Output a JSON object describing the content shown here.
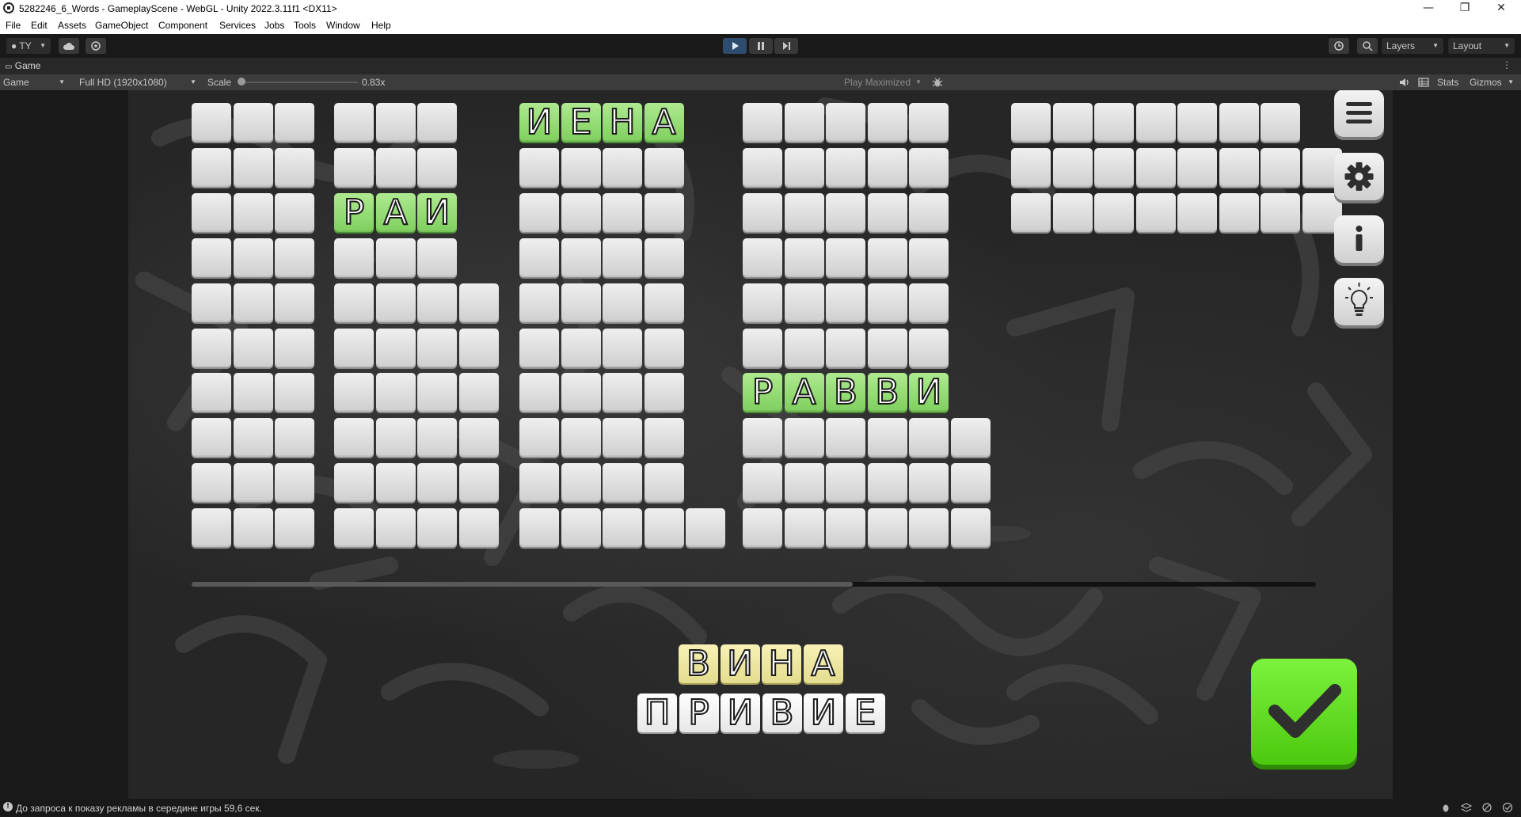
{
  "window": {
    "title": "5282246_6_Words - GameplayScene - WebGL - Unity 2022.3.11f1 <DX11>",
    "minimize": "—",
    "maximize": "❐",
    "close": "✕"
  },
  "menu": [
    "File",
    "Edit",
    "Assets",
    "GameObject",
    "Component",
    "Services",
    "Jobs",
    "Tools",
    "Window",
    "Help"
  ],
  "toolbar": {
    "account": "TY",
    "layers": "Layers",
    "layout": "Layout",
    "play_icon": "play-icon",
    "pause_icon": "pause-icon",
    "step_icon": "step-icon"
  },
  "game_tab": {
    "label": "Game",
    "display": "Game",
    "resolution": "Full HD (1920x1080)",
    "scale_label": "Scale",
    "scale_value": "0.83x",
    "play_mode": "Play Maximized",
    "stats": "Stats",
    "gizmos": "Gizmos"
  },
  "board": {
    "found_words": [
      {
        "word": "ИЕНА",
        "letters": [
          "И",
          "Е",
          "Н",
          "А"
        ]
      },
      {
        "word": "РАИ",
        "letters": [
          "Р",
          "А",
          "И"
        ]
      },
      {
        "word": "РАВВИ",
        "letters": [
          "Р",
          "А",
          "В",
          "В",
          "И"
        ]
      }
    ],
    "current_word": {
      "letters": [
        "В",
        "И",
        "Н",
        "А"
      ]
    },
    "available_letters": [
      "П",
      "Р",
      "И",
      "В",
      "И",
      "Е"
    ]
  },
  "side_buttons": [
    "menu-icon",
    "settings-icon",
    "info-icon",
    "hint-icon"
  ],
  "status": {
    "message": "До запроса к показу рекламы в середине игры 59,6 сек."
  }
}
